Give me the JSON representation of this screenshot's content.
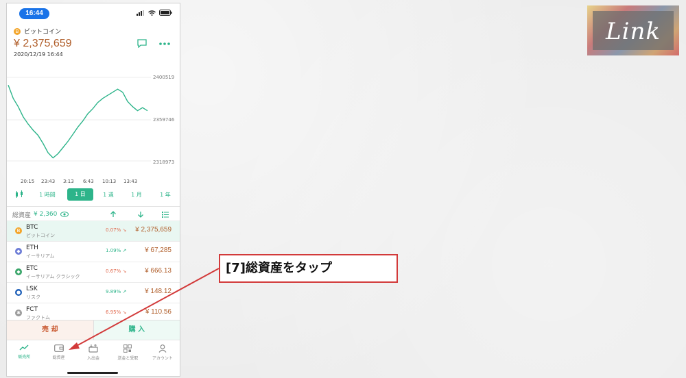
{
  "status": {
    "time": "16:44"
  },
  "coin": {
    "icon_letter": "B",
    "name": "ビットコイン",
    "price": "¥ 2,375,659",
    "date": "2020/12/19 16:44"
  },
  "chart_data": {
    "type": "line",
    "ylim": [
      2318973,
      2400519
    ],
    "yticks": [
      "2400519",
      "2359746",
      "2318973"
    ],
    "xticks": [
      "20:15",
      "23:43",
      "3:13",
      "6:43",
      "10:13",
      "13:43"
    ],
    "values": [
      2393000,
      2380000,
      2372000,
      2362000,
      2355000,
      2349000,
      2344000,
      2336000,
      2327000,
      2322000,
      2326000,
      2332000,
      2338000,
      2345000,
      2352000,
      2358000,
      2365000,
      2370000,
      2376000,
      2380000,
      2383000,
      2386000,
      2389000,
      2386000,
      2377000,
      2372000,
      2368000,
      2371000,
      2368000
    ],
    "color": "#2db48a"
  },
  "periods": {
    "one_hour": "1 時間",
    "one_day": "1 日",
    "one_week": "1 週",
    "one_month": "1 月",
    "one_year": "1 年"
  },
  "assets": {
    "label": "総資産",
    "value": "¥ 2,360"
  },
  "coins": [
    {
      "icon": "B",
      "color": "#f3a52a",
      "symbol": "BTC",
      "name": "ビットコイン",
      "change": "0.07%",
      "change_color": "#e0664a",
      "arrow": "↘",
      "price": "¥ 2,375,659"
    },
    {
      "icon": "◆",
      "color": "#6b7bd6",
      "symbol": "ETH",
      "name": "イーサリアム",
      "change": "1.09%",
      "change_color": "#2db48a",
      "arrow": "↗",
      "price": "¥ 67,285"
    },
    {
      "icon": "◆",
      "color": "#3aa66a",
      "symbol": "ETC",
      "name": "イーサリアム クラシック",
      "change": "0.67%",
      "change_color": "#e0664a",
      "arrow": "↘",
      "price": "¥ 666.13"
    },
    {
      "icon": "●",
      "color": "#1d5fb8",
      "symbol": "LSK",
      "name": "リスク",
      "change": "9.89%",
      "change_color": "#2db48a",
      "arrow": "↗",
      "price": "¥ 148.12"
    },
    {
      "icon": "✱",
      "color": "#9a9a9a",
      "symbol": "FCT",
      "name": "ファクトム",
      "change": "6.95%",
      "change_color": "#e0664a",
      "arrow": "↘",
      "price": "¥ 110.56"
    }
  ],
  "trade": {
    "sell": "売 却",
    "buy": "購 入"
  },
  "tabs": {
    "exchange": "販売所",
    "assets": "総資産",
    "deposit": "入出金",
    "send": "送金と受取",
    "account": "アカウント"
  },
  "callout": {
    "text": "[7]総資産をタップ"
  },
  "logo": {
    "text": "Link"
  }
}
